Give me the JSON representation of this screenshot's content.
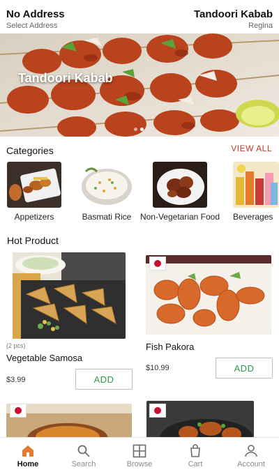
{
  "header": {
    "address_title": "No Address",
    "address_sub": "Select Address",
    "store_title": "Tandoori Kabab",
    "store_sub": "Regina"
  },
  "banner": {
    "caption": "Tandoori Kabab",
    "slides": 2,
    "active_slide": 1
  },
  "categories": {
    "title": "Categories",
    "view_all": "VIEW ALL",
    "items": [
      {
        "label": "Appetizers"
      },
      {
        "label": "Basmati Rice"
      },
      {
        "label": "Non-Vegetarian Food"
      },
      {
        "label": "Beverages"
      }
    ]
  },
  "hot": {
    "title": "Hot Product",
    "products": [
      {
        "qty": "(2 pcs)",
        "name": "Vegetable Samosa",
        "price": "$3.99",
        "add": "ADD"
      },
      {
        "qty": "",
        "name": "Fish Pakora",
        "price": "$10.99",
        "add": "ADD"
      }
    ]
  },
  "tabs": [
    {
      "label": "Home",
      "icon": "home-icon",
      "active": true
    },
    {
      "label": "Search",
      "icon": "search-icon",
      "active": false
    },
    {
      "label": "Browse",
      "icon": "browse-grid-icon",
      "active": false
    },
    {
      "label": "Cart",
      "icon": "cart-icon",
      "active": false
    },
    {
      "label": "Account",
      "icon": "account-icon",
      "active": false
    }
  ],
  "colors": {
    "accent": "#c8372d",
    "add_green": "#2e9c46",
    "tab_active_icon": "#e07b2f"
  }
}
